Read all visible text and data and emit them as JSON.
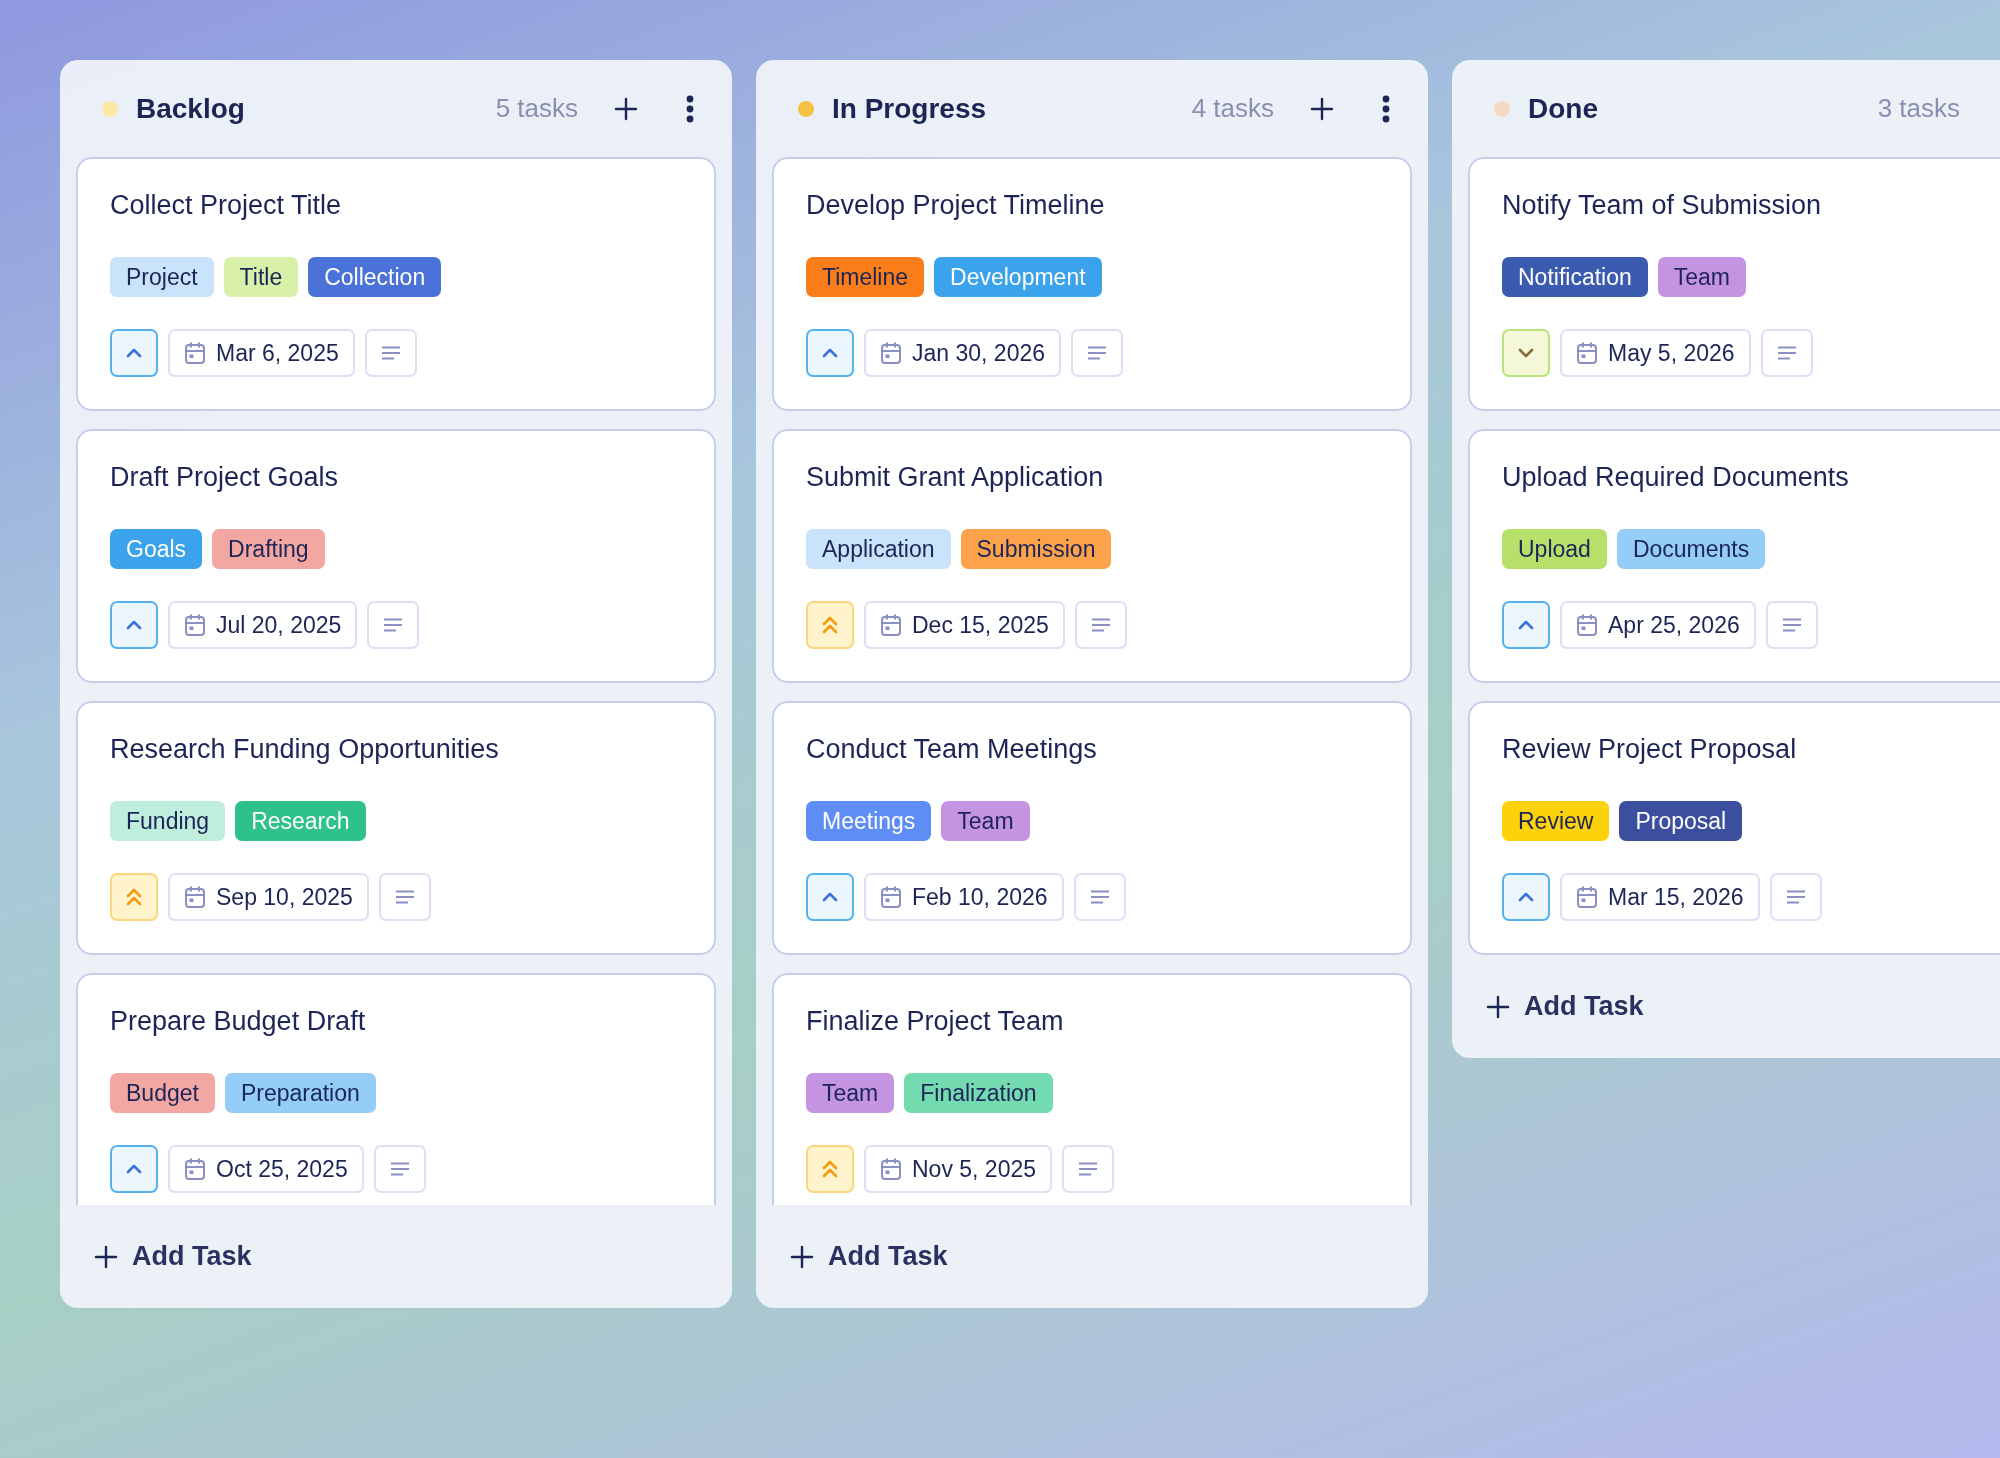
{
  "columns": [
    {
      "title": "Backlog",
      "color": "#fbe7a6",
      "count": "5 tasks",
      "show_actions": true,
      "add_label": "Add Task",
      "cards": [
        {
          "title": "Collect Project Title",
          "kind": "medium",
          "date": "Mar 6, 2025",
          "tags": [
            {
              "label": "Project",
              "color": "#c9e3fa"
            },
            {
              "label": "Title",
              "color": "#d8f0a8"
            },
            {
              "label": "Collection",
              "color": "#4a72d8"
            }
          ]
        },
        {
          "title": "Draft Project Goals",
          "kind": "medium",
          "date": "Jul 20, 2025",
          "tags": [
            {
              "label": "Goals",
              "color": "#3aa3ec"
            },
            {
              "label": "Drafting",
              "color": "#f2a7a3"
            }
          ]
        },
        {
          "title": "Research Funding Opportunities",
          "kind": "high",
          "date": "Sep 10, 2025",
          "tags": [
            {
              "label": "Funding",
              "color": "#bfeedd"
            },
            {
              "label": "Research",
              "color": "#2ec28a"
            }
          ]
        },
        {
          "title": "Prepare Budget Draft",
          "kind": "medium",
          "date": "Oct 25, 2025",
          "tags": [
            {
              "label": "Budget",
              "color": "#f2a7a3"
            },
            {
              "label": "Preparation",
              "color": "#93cdf8"
            }
          ]
        }
      ]
    },
    {
      "title": "In Progress",
      "color": "#f5c243",
      "count": "4 tasks",
      "show_actions": true,
      "add_label": "Add Task",
      "cards": [
        {
          "title": "Develop Project Timeline",
          "kind": "medium",
          "date": "Jan 30, 2026",
          "tags": [
            {
              "label": "Timeline",
              "color": "#fb7d1a"
            },
            {
              "label": "Development",
              "color": "#3aa3ec"
            }
          ]
        },
        {
          "title": "Submit Grant Application",
          "kind": "high",
          "date": "Dec 15, 2025",
          "tags": [
            {
              "label": "Application",
              "color": "#c9e3fa"
            },
            {
              "label": "Submission",
              "color": "#fca24a"
            }
          ]
        },
        {
          "title": "Conduct Team Meetings",
          "kind": "medium",
          "date": "Feb 10, 2026",
          "tags": [
            {
              "label": "Meetings",
              "color": "#5e8ef5"
            },
            {
              "label": "Team",
              "color": "#c493e2"
            }
          ]
        },
        {
          "title": "Finalize Project Team",
          "kind": "high",
          "date": "Nov 5, 2025",
          "tags": [
            {
              "label": "Team",
              "color": "#c493e2"
            },
            {
              "label": "Finalization",
              "color": "#74dab0"
            }
          ]
        }
      ]
    },
    {
      "title": "Done",
      "color": "#f5d9c3",
      "count": "3 tasks",
      "show_actions": false,
      "add_label": "Add Task",
      "cards": [
        {
          "title": "Notify Team of Submission",
          "kind": "low",
          "date": "May 5, 2026",
          "tags": [
            {
              "label": "Notification",
              "color": "#3b5bb0"
            },
            {
              "label": "Team",
              "color": "#c493e2"
            }
          ]
        },
        {
          "title": "Upload Required Documents",
          "kind": "medium",
          "date": "Apr 25, 2026",
          "tags": [
            {
              "label": "Upload",
              "color": "#b6e06a"
            },
            {
              "label": "Documents",
              "color": "#93cdf8"
            }
          ]
        },
        {
          "title": "Review Project Proposal",
          "kind": "medium",
          "date": "Mar 15, 2026",
          "tags": [
            {
              "label": "Review",
              "color": "#fcd20a"
            },
            {
              "label": "Proposal",
              "color": "#3b4f9e"
            }
          ]
        }
      ]
    }
  ]
}
